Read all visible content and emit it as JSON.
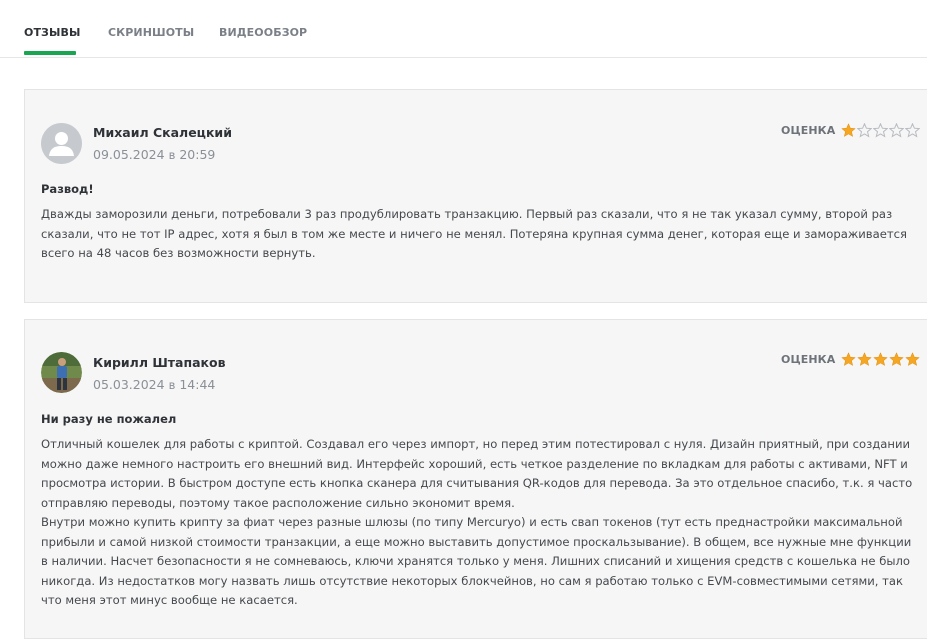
{
  "tabs": [
    {
      "label": "ОТЗЫВЫ",
      "active": true
    },
    {
      "label": "СКРИНШОТЫ",
      "active": false
    },
    {
      "label": "ВИДЕООБЗОР",
      "active": false
    }
  ],
  "accent_color": "#1aa551",
  "star_color": "#f5a623",
  "reviews": [
    {
      "author": "Михаил Скалецкий",
      "date": "09.05.2024",
      "time_sep": "в",
      "time": "20:59",
      "rating_label": "ОЦЕНКА",
      "rating": 1,
      "rating_max": 5,
      "avatar": "default-user-icon",
      "title": "Развод!",
      "paragraphs": [
        "Дважды заморозили деньги, потребовали 3 раз продублировать транзакцию. Первый раз сказали, что я не так указал сумму, второй раз сказали, что не тот IP адрес, хотя я был в том же месте и ничего не менял. Потеряна крупная сумма денег, которая еще и замораживается всего на 48 часов без возможности вернуть."
      ]
    },
    {
      "author": "Кирилл Штапаков",
      "date": "05.03.2024",
      "time_sep": "в",
      "time": "14:44",
      "rating_label": "ОЦЕНКА",
      "rating": 5,
      "rating_max": 5,
      "avatar": "user-photo",
      "title": "Ни разу не пожалел",
      "paragraphs": [
        "Отличный кошелек для работы с криптой. Создавал его через импорт, но перед этим потестировал с нуля. Дизайн приятный, при создании можно даже немного настроить его внешний вид. Интерфейс хороший, есть четкое разделение по вкладкам для работы с активами, NFT и просмотра истории. В быстром доступе есть кнопка сканера для считывания QR-кодов для перевода. За это отдельное спасибо, т.к. я часто отправляю переводы, поэтому такое расположение сильно экономит время.",
        "Внутри можно купить крипту за фиат через разные шлюзы (по типу Mercuryo) и есть свап токенов (тут есть преднастройки максимальной прибыли и самой низкой стоимости транзакции, а еще можно выставить допустимое проскальзывание). В общем, все нужные мне функции в наличии. Насчет безопасности я не сомневаюсь, ключи хранятся только у меня. Лишних списаний и хищения средств с кошелька не было никогда. Из недостатков могу назвать лишь отсутствие некоторых блокчейнов, но сам я работаю только с EVM-совместимыми сетями, так что меня этот минус вообще не касается."
      ]
    }
  ]
}
